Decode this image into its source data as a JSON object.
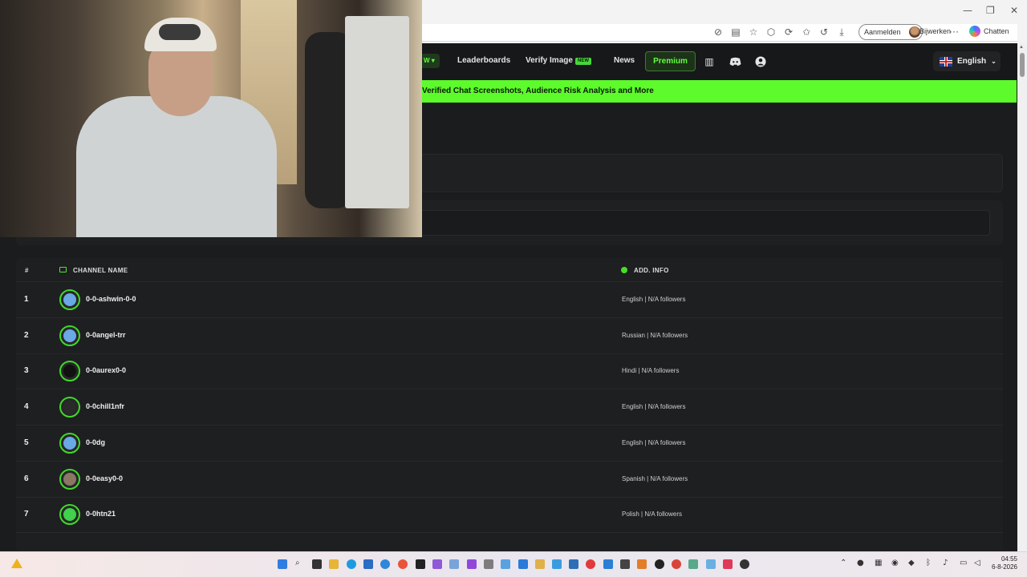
{
  "browser": {
    "signin_label": "Aanmelden",
    "update_label": "Bijwerken",
    "more_label": "···",
    "chat_label": "Chatten",
    "window_controls": [
      "—",
      "❐",
      "✕"
    ],
    "toolbar_icons": [
      "no-track-icon",
      "reader-icon",
      "star-icon",
      "extension-icon",
      "edge-icon",
      "favorites-icon",
      "history-icon",
      "download-icon"
    ]
  },
  "nav": {
    "partial_label": "W",
    "leaderboards": "Leaderboards",
    "verify_image": "Verify Image",
    "new_badge": "NEW",
    "news": "News",
    "premium": "Premium",
    "language": "English"
  },
  "banner": {
    "text": "Verified Chat Screenshots, Audience Risk Analysis and More"
  },
  "table": {
    "headers": {
      "rank": "#",
      "channel": "CHANNEL NAME",
      "info": "ADD. INFO"
    },
    "rows": [
      {
        "rank": "1",
        "name": "0-0-ashwin-0-0",
        "info": "English | N/A followers",
        "avatar_color": "#6aa8e6"
      },
      {
        "rank": "2",
        "name": "0-0angel-trr",
        "info": "Russian | N/A followers",
        "avatar_color": "#6aa8e6"
      },
      {
        "rank": "3",
        "name": "0-0aurex0-0",
        "info": "Hindi | N/A followers",
        "avatar_color": "#111111"
      },
      {
        "rank": "4",
        "name": "0-0chill1nfr",
        "info": "English | N/A followers",
        "avatar_color": "#2a2a2a"
      },
      {
        "rank": "5",
        "name": "0-0dg",
        "info": "English | N/A followers",
        "avatar_color": "#6aa8e6"
      },
      {
        "rank": "6",
        "name": "0-0easy0-0",
        "info": "Spanish | N/A followers",
        "avatar_color": "#8b7766"
      },
      {
        "rank": "7",
        "name": "0-0htn21",
        "info": "Polish | N/A followers",
        "avatar_color": "#3fd24a"
      }
    ]
  },
  "colors": {
    "accent_green": "#5dfa2c",
    "background": "#1b1c1e"
  },
  "system": {
    "time": "04:55",
    "date": "6-8-2026"
  }
}
